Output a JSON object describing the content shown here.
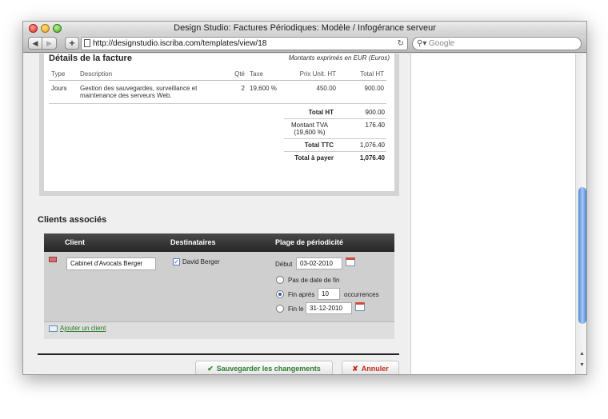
{
  "window": {
    "title": "Design Studio: Factures Périodiques: Modèle / Infogérance serveur",
    "url": "http://designstudio.iscriba.com/templates/view/18",
    "search_placeholder": "Google"
  },
  "invoice": {
    "title": "Détails de la facture",
    "currency_note": "Montants exprimés en EUR (Euros)",
    "columns": [
      "Type",
      "Description",
      "Qté",
      "Taxe",
      "Prix Unit. HT",
      "Total HT"
    ],
    "rows": [
      {
        "type": "Jours",
        "description": "Gestion des sauvegardes, surveillance et maintenance des serveurs Web.",
        "qty": "2",
        "tax": "19,600 %",
        "unit_price": "450.00",
        "total": "900.00"
      }
    ],
    "totals": {
      "total_ht_label": "Total HT",
      "total_ht": "900.00",
      "tva_label": "Montant TVA (19,600 %)",
      "tva": "176.40",
      "ttc_label": "Total TTC",
      "ttc": "1,076.40",
      "pay_label": "Total à payer",
      "pay": "1,076.40"
    }
  },
  "clients": {
    "section_title": "Clients associés",
    "headers": {
      "client": "Client",
      "recipients": "Destinataires",
      "periodicity": "Plage de périodicité"
    },
    "client_value": "Cabinet d'Avocats Berger",
    "recipient_name": "David Berger",
    "start_label": "Début",
    "start_date": "03-02-2010",
    "opt_no_end": "Pas de date de fin",
    "opt_after": "Fin après",
    "after_count": "10",
    "occurrences_label": "occurrences",
    "opt_end_on": "Fin le",
    "end_date": "31-12-2010",
    "add_client": "Ajouter un client",
    "selected_option": "Fin après"
  },
  "actions": {
    "save": "Sauvegarder les changements",
    "cancel": "Annuler"
  },
  "icons": {
    "close": "close-icon",
    "minimize": "minimize-icon",
    "maximize": "maximize-icon",
    "back": "back-arrow-icon",
    "forward": "forward-arrow-icon",
    "add": "plus-icon",
    "page": "page-icon",
    "reload": "reload-icon",
    "search": "search-icon",
    "delete": "delete-client-icon",
    "calendar": "calendar-icon",
    "check": "checkmark-icon",
    "cross": "cross-icon"
  },
  "colors": {
    "accent_green": "#2e7d2e",
    "cancel_red": "#c42a1a",
    "link_green": "#2a7a2a",
    "scroll_blue": "#4a86d6"
  }
}
